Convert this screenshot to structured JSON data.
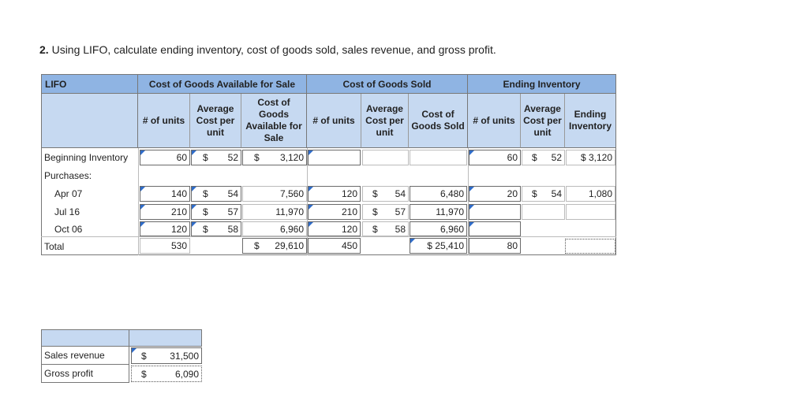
{
  "question": {
    "number": "2.",
    "text": "Using LIFO, calculate ending inventory, cost of goods sold, sales revenue, and gross profit."
  },
  "headers": {
    "lifo": "LIFO",
    "cogas": "Cost of Goods Available for Sale",
    "cogs": "Cost of Goods Sold",
    "ending": "Ending Inventory"
  },
  "subheaders": {
    "units_a": "# of units",
    "avg_a": "Average Cost per unit",
    "cost_a": "Cost of Goods Available for Sale",
    "units_b": "# of units",
    "avg_b": "Average Cost per unit",
    "cost_b": "Cost of Goods Sold",
    "units_c": "# of units",
    "avg_c": "Average Cost per unit",
    "cost_c": "Ending Inventory"
  },
  "rows": {
    "beg": {
      "label": "Beginning Inventory",
      "units": "60",
      "cur1": "$",
      "avg": "52",
      "cur2": "$",
      "cost": "3,120",
      "e_units": "60",
      "e_cur1": "$",
      "e_avg": "52",
      "e_cost": "$ 3,120"
    },
    "purch": {
      "label": "Purchases:"
    },
    "apr": {
      "label": "Apr 07",
      "units": "140",
      "cur1": "$",
      "avg": "54",
      "cost": "7,560",
      "s_units": "120",
      "s_cur": "$",
      "s_avg": "54",
      "s_cost": "6,480",
      "e_units": "20",
      "e_cur1": "$",
      "e_avg": "54",
      "e_cost": "1,080"
    },
    "jul": {
      "label": "Jul 16",
      "units": "210",
      "cur1": "$",
      "avg": "57",
      "cost": "11,970",
      "s_units": "210",
      "s_cur": "$",
      "s_avg": "57",
      "s_cost": "11,970"
    },
    "oct": {
      "label": "Oct 06",
      "units": "120",
      "cur1": "$",
      "avg": "58",
      "cost": "6,960",
      "s_units": "120",
      "s_cur": "$",
      "s_avg": "58",
      "s_cost": "6,960"
    },
    "total": {
      "label": "Total",
      "units": "530",
      "cur2": "$",
      "cost": "29,610",
      "s_units": "450",
      "s_cost": "$ 25,410",
      "e_units": "80"
    }
  },
  "summary": {
    "sales_label": "Sales revenue",
    "sales_cur": "$",
    "sales_value": "31,500",
    "gp_label": "Gross profit",
    "gp_cur": "$",
    "gp_value": "6,090"
  }
}
